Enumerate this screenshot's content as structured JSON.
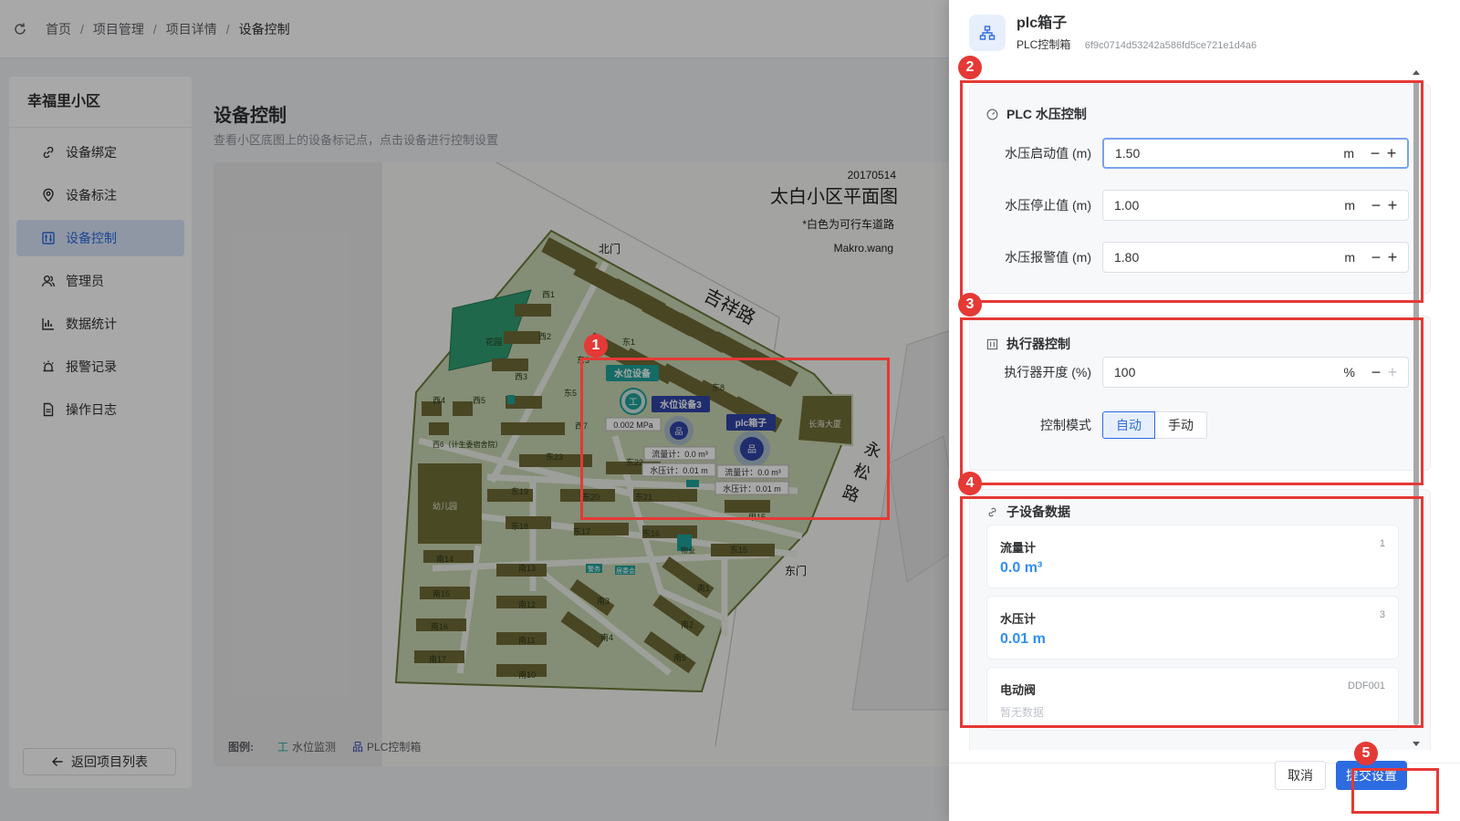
{
  "breadcrumb": [
    "首页",
    "项目管理",
    "项目详情",
    "设备控制"
  ],
  "sidebar": {
    "title": "幸福里小区",
    "items": [
      {
        "label": "设备绑定",
        "icon": "link-icon"
      },
      {
        "label": "设备标注",
        "icon": "location-pin-icon"
      },
      {
        "label": "设备控制",
        "icon": "control-panel-icon",
        "active": true
      },
      {
        "label": "管理员",
        "icon": "users-icon"
      },
      {
        "label": "数据统计",
        "icon": "bar-chart-icon"
      },
      {
        "label": "报警记录",
        "icon": "alarm-icon"
      },
      {
        "label": "操作日志",
        "icon": "document-icon"
      }
    ],
    "back_label": "返回项目列表"
  },
  "main": {
    "title": "设备控制",
    "subtitle": "查看小区底图上的设备标记点，点击设备进行控制设置"
  },
  "map": {
    "date": "20170514",
    "title": "太白小区平面图",
    "note": "*白色为可行车道路",
    "author": "Makro.wang",
    "gates": {
      "north": "北门",
      "east": "东门"
    },
    "roads": {
      "jixiang": "吉祥路",
      "yong": "永",
      "song": "松",
      "lu": "路"
    },
    "areas": {
      "garden": "花园",
      "kindergarten": "幼儿园",
      "changhai": "长海大厦",
      "xi1": "西1",
      "xi2": "西2",
      "xi3": "西3",
      "xi4": "西4",
      "xi5": "西5",
      "xi6": "西6（计生委宿舍院）",
      "xi7": "西7",
      "dong1": "东1",
      "dong3": "东3",
      "dong5": "东5",
      "dong8": "东8",
      "dong15": "东15",
      "dong16": "东16",
      "dong17": "东17",
      "dong18": "东18",
      "dong19": "东19",
      "dong20": "东20",
      "dong21": "东21",
      "dong22": "东22",
      "dong23": "东23",
      "jia15": "甲15",
      "wuye": "物业",
      "jingwu": "警务",
      "jumin": "居委会",
      "nan1": "南1",
      "nan2": "南2",
      "nan3": "南3",
      "nan4": "南4",
      "nan5": "南5",
      "nan10": "南10",
      "nan11": "南11",
      "nan12": "南12",
      "nan13": "南13",
      "nan14": "南14",
      "nan15": "南15",
      "nan16": "南16",
      "nan17": "南17"
    },
    "markers": [
      {
        "name": "水位设备",
        "reading": "0.002 MPa"
      },
      {
        "name": "水位设备3",
        "flow": "流量计：0.0 m³",
        "pressure": "水压计：0.01 m"
      },
      {
        "name": "plc箱子",
        "flow": "流量计：0.0 m³",
        "pressure": "水压计：0.01 m"
      }
    ]
  },
  "legend": {
    "title": "图例:",
    "water_level": "水位监测",
    "plc": "PLC控制箱"
  },
  "drawer": {
    "name": "plc箱子",
    "type": "PLC控制箱",
    "hash": "6f9c0714d53242a586fd5ce721e1d4a6",
    "pressure_section": {
      "title": "PLC 水压控制",
      "fields": [
        {
          "label": "水压启动值 (m)",
          "value": "1.50",
          "unit": "m"
        },
        {
          "label": "水压停止值 (m)",
          "value": "1.00",
          "unit": "m"
        },
        {
          "label": "水压报警值 (m)",
          "value": "1.80",
          "unit": "m"
        }
      ]
    },
    "actuator_section": {
      "title": "执行器控制",
      "opening_label": "执行器开度 (%)",
      "opening_value": "100",
      "opening_unit": "%",
      "mode_label": "控制模式",
      "mode_auto": "自动",
      "mode_manual": "手动",
      "mode_selected": "自动"
    },
    "subdevice_section": {
      "title": "子设备数据",
      "items": [
        {
          "name": "流量计",
          "id": "1",
          "value": "0.0 m³"
        },
        {
          "name": "水压计",
          "id": "3",
          "value": "0.01 m"
        },
        {
          "name": "电动阀",
          "id": "DDF001",
          "empty": "暂无数据"
        }
      ]
    },
    "cancel_label": "取消",
    "submit_label": "提交设置"
  },
  "annotations": [
    "1",
    "2",
    "3",
    "4",
    "5"
  ],
  "colors": {
    "accent": "#2d6be0",
    "teal": "#1fa39a",
    "annotation": "#e53935",
    "value_blue": "#2f8ff0"
  }
}
